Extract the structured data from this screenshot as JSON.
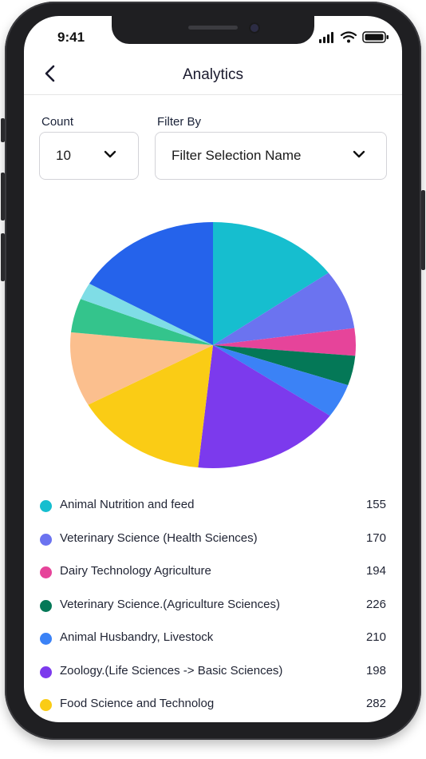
{
  "status": {
    "time": "9:41"
  },
  "header": {
    "title": "Analytics"
  },
  "filters": {
    "count_label": "Count",
    "count_value": "10",
    "filter_label": "Filter By",
    "filter_value": "Filter Selection Name"
  },
  "chart_data": {
    "type": "pie",
    "slices": [
      {
        "label": "Animal Nutrition and feed",
        "value": 155,
        "color": "#16BECF"
      },
      {
        "label": "Veterinary Science (Health Sciences)",
        "value": 170,
        "color": "#6B73F0"
      },
      {
        "label": "Dairy Technology Agriculture",
        "value": 194,
        "color": "#E6449A"
      },
      {
        "label": "Veterinary Science.(Agriculture Sciences)",
        "value": 226,
        "color": "#047857"
      },
      {
        "label": "Animal Husbandry, Livestock",
        "value": 210,
        "color": "#3B82F6"
      },
      {
        "label": "Zoology.(Life Sciences -> Basic Sciences)",
        "value": 198,
        "color": "#7C3AED"
      },
      {
        "label": "Food Science and Technolog",
        "value": 282,
        "color": "#FACC15"
      }
    ],
    "unlisted_slice_colors": [
      "#FBBF8E",
      "#34C48C",
      "#7FDDE6",
      "#2563EB"
    ]
  }
}
